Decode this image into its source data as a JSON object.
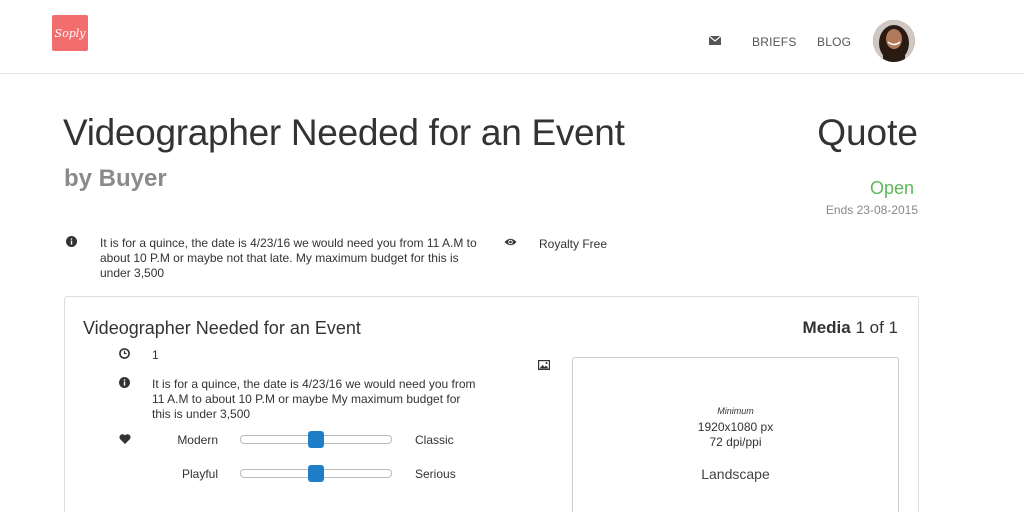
{
  "header": {
    "logo_text": "Soply",
    "nav": {
      "mail_icon": "envelope-icon",
      "briefs": "BRIEFS",
      "blog": "BLOG"
    },
    "avatar": "user-avatar"
  },
  "brief": {
    "title": "Videographer Needed for an Event",
    "byline": "by Buyer",
    "type": "Quote",
    "status": "Open",
    "ends": "Ends 23-08-2015",
    "description": "It is for a quince, the date is 4/23/16 we would need you from 11 A.M to about 10 P.M or maybe not that late. My maximum budget for this is under 3,500",
    "license": "Royalty Free",
    "status_color": "#5cb85c"
  },
  "card": {
    "title": "Videographer Needed for an Event",
    "media_word": "Media",
    "media_count": "1 of 1",
    "count": "1",
    "description": "It is for a quince, the date is 4/23/16 we would need you from 11 A.M to about 10 P.M or maybe My maximum budget for this is under 3,500",
    "sliders": [
      {
        "left": "Modern",
        "right": "Classic",
        "value": 0.5
      },
      {
        "left": "Playful",
        "right": "Serious",
        "value": 0.5
      }
    ],
    "media_spec": {
      "min_label": "Minimum",
      "resolution": "1920x1080 px",
      "dpi": "72 dpi/ppi",
      "orientation": "Landscape"
    }
  },
  "colors": {
    "brand": "#f26d6d",
    "accent": "#1e7fc8"
  }
}
